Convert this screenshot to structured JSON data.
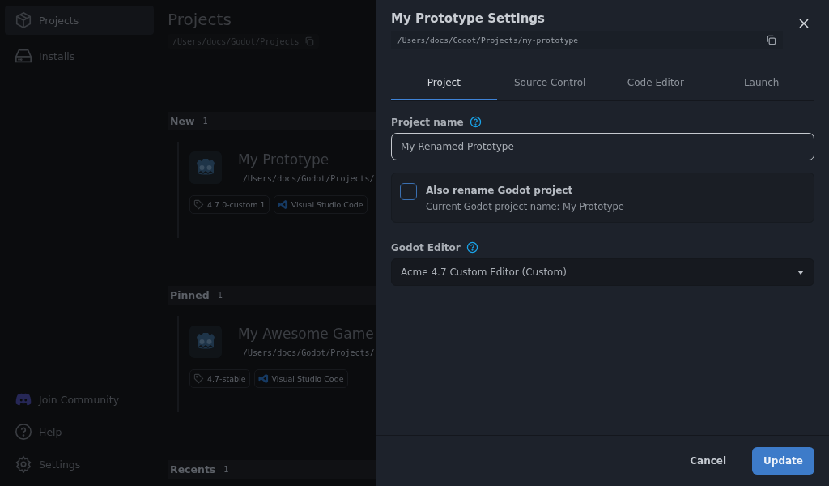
{
  "sidebar": {
    "items": [
      {
        "kind": "projects",
        "label": "Projects",
        "selected": true
      },
      {
        "kind": "installs",
        "label": "Installs",
        "selected": false
      }
    ],
    "footer_items": [
      {
        "kind": "community",
        "label": "Join Community"
      },
      {
        "kind": "help",
        "label": "Help"
      },
      {
        "kind": "settings",
        "label": "Settings"
      }
    ]
  },
  "page": {
    "title": "Projects",
    "path": "/Users/docs/Godot/Projects",
    "sections": [
      {
        "title": "New",
        "count": "1",
        "projects": [
          {
            "name": "My Prototype",
            "path": "/Users/docs/Godot/Projects/",
            "tags": [
              {
                "kind": "version",
                "label": "4.7.0-custom.1"
              },
              {
                "kind": "editor",
                "label": "Visual Studio Code"
              }
            ]
          }
        ]
      },
      {
        "title": "Pinned",
        "count": "1",
        "projects": [
          {
            "name": "My Awesome Game",
            "path": "/Users/docs/Godot/Projects/",
            "tags": [
              {
                "kind": "version",
                "label": "4.7-stable"
              },
              {
                "kind": "editor",
                "label": "Visual Studio Code"
              }
            ]
          }
        ]
      },
      {
        "title": "Recents",
        "count": "1"
      }
    ]
  },
  "dialog": {
    "title": "My Prototype Settings",
    "path": "/Users/docs/Godot/Projects/my-prototype",
    "tabs": [
      {
        "label": "Project",
        "selected": true
      },
      {
        "label": "Source Control",
        "selected": false
      },
      {
        "label": "Code Editor",
        "selected": false
      },
      {
        "label": "Launch",
        "selected": false
      }
    ],
    "project_name": {
      "label": "Project name",
      "value": "My Renamed Prototype"
    },
    "rename_option": {
      "label": "Also rename Godot project",
      "description": "Current Godot project name: My Prototype",
      "checked": false
    },
    "godot_editor": {
      "label": "Godot Editor",
      "value": "Acme 4.7 Custom Editor (Custom)"
    },
    "buttons": [
      {
        "kind": "secondary",
        "label": "Cancel"
      },
      {
        "kind": "primary",
        "label": "Update"
      }
    ]
  }
}
